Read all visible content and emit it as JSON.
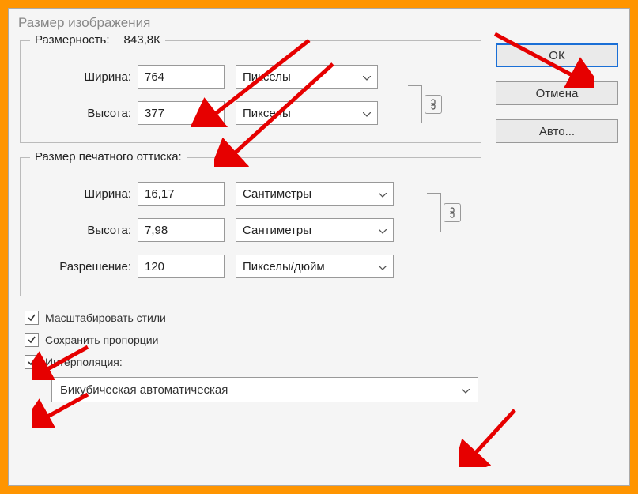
{
  "dialog": {
    "title": "Размер изображения"
  },
  "pixelDimensions": {
    "legend": "Размерность:",
    "filesize": "843,8К",
    "widthLabel": "Ширина:",
    "widthValue": "764",
    "widthUnit": "Пикселы",
    "heightLabel": "Высота:",
    "heightValue": "377",
    "heightUnit": "Пикселы"
  },
  "documentSize": {
    "legend": "Размер печатного оттиска:",
    "widthLabel": "Ширина:",
    "widthValue": "16,17",
    "widthUnit": "Сантиметры",
    "heightLabel": "Высота:",
    "heightValue": "7,98",
    "heightUnit": "Сантиметры",
    "resolutionLabel": "Разрешение:",
    "resolutionValue": "120",
    "resolutionUnit": "Пикселы/дюйм"
  },
  "checkboxes": {
    "scaleStyles": "Масштабировать стили",
    "constrainProportions": "Сохранить пропорции",
    "resample": "Интерполяция:"
  },
  "resampleMethod": "Бикубическая автоматическая",
  "buttons": {
    "ok": "ОК",
    "cancel": "Отмена",
    "auto": "Авто..."
  }
}
